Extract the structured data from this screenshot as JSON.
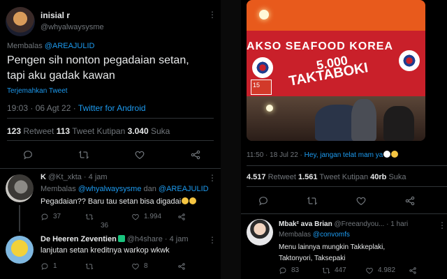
{
  "left": {
    "main": {
      "name": "inisial r",
      "handle": "@whyalwaysysme",
      "reply_prefix": "Membalas",
      "reply_to": "@AREAJULID",
      "text_line1": "Pengen sih nonton pegadaian setan,",
      "text_line2": "tapi aku gadak kawan",
      "translate": "Terjemahkan Tweet",
      "time": "19:03 · 06 Agt 22 · ",
      "client": "Twitter for Android",
      "retweets_num": "123",
      "retweets_label": " Retweet  ",
      "quotes_num": "113",
      "quotes_label": " Tweet Kutipan  ",
      "likes_num": "3.040",
      "likes_label": " Suka"
    },
    "reply1": {
      "name": "K",
      "handle_time": "@Kt_xkta · 4 jam",
      "reply_prefix": "Membalas",
      "reply_to1": "@whyalwaysysme",
      "reply_and": " dan ",
      "reply_to2": "@AREAJULID",
      "text": "Pegadaian?? Baru tau setan bisa digadai",
      "replies": "37",
      "retweets": "36",
      "likes": "1.994"
    },
    "reply2": {
      "name": "De Heeren Zeventien",
      "handle_time": "@h4share · 4 jam",
      "text": "lanjutan setan kreditnya warkop wkwk",
      "replies": "1",
      "likes": "8"
    }
  },
  "right": {
    "photo": {
      "banner_top": "AKSO SEAFOOD KOREA",
      "price": "5.000",
      "product": "TAKTABOKI",
      "sign": "15"
    },
    "time": "11:50 · 18 Jul 22 · ",
    "caption": "Hey, jangan telat mam ya",
    "retweets_num": "4.517",
    "retweets_label": " Retweet  ",
    "quotes_num": "1.561",
    "quotes_label": " Tweet Kutipan  ",
    "likes_num": "40rb",
    "likes_label": " Suka",
    "reply": {
      "name": "Mbak² ava Brian",
      "handle_time": "@Freeandyou... · 1 hari",
      "reply_prefix": "Membalas",
      "reply_to": "@convomfs",
      "text_line1": "Menu lainnya mungkin Takkeplaki,",
      "text_line2": "Taktonyori, Taksepaki",
      "replies": "83",
      "retweets": "447",
      "likes": "4.982"
    }
  },
  "icons": {
    "reply": "reply-icon",
    "retweet": "retweet-icon",
    "like": "heart-icon",
    "share": "share-icon",
    "more": "more-icon"
  },
  "colors": {
    "accent": "#1d9bf0",
    "muted": "#71767b",
    "text": "#e7e9ea",
    "background": "#000000"
  }
}
